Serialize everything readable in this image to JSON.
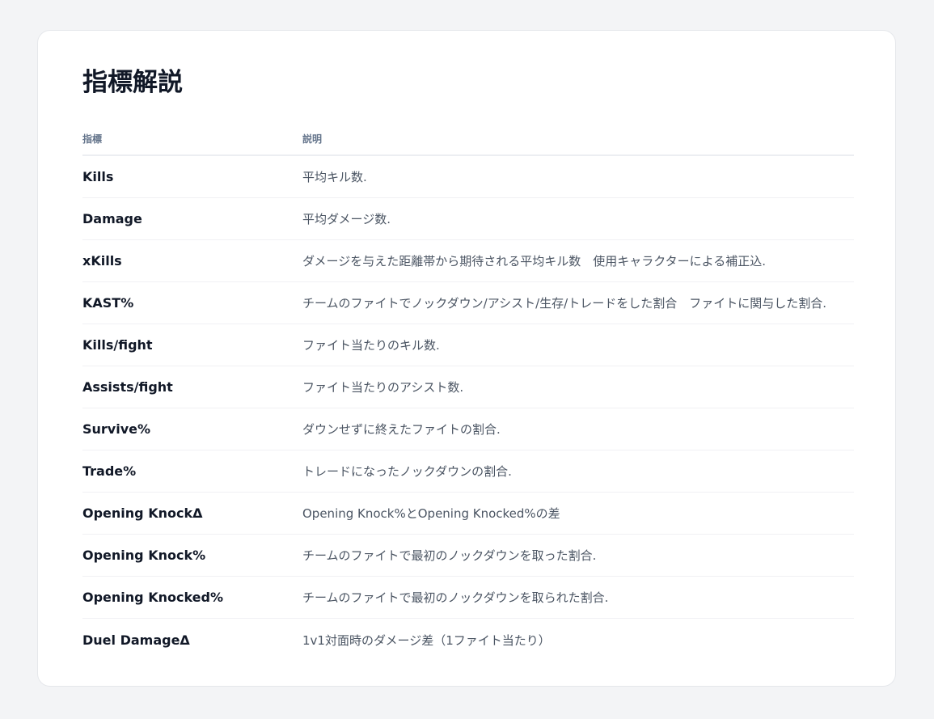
{
  "title": "指標解説",
  "table": {
    "headers": {
      "metric": "指標",
      "description": "説明"
    },
    "rows": [
      {
        "metric": "Kills",
        "description": "平均キル数."
      },
      {
        "metric": "Damage",
        "description": "平均ダメージ数."
      },
      {
        "metric": "xKills",
        "description": "ダメージを与えた距離帯から期待される平均キル数　使用キャラクターによる補正込."
      },
      {
        "metric": "KAST%",
        "description": "チームのファイトでノックダウン/アシスト/生存/トレードをした割合　ファイトに関与した割合."
      },
      {
        "metric": "Kills/fight",
        "description": "ファイト当たりのキル数."
      },
      {
        "metric": "Assists/fight",
        "description": "ファイト当たりのアシスト数."
      },
      {
        "metric": "Survive%",
        "description": "ダウンせずに終えたファイトの割合."
      },
      {
        "metric": "Trade%",
        "description": "トレードになったノックダウンの割合."
      },
      {
        "metric": "Opening KnockΔ",
        "description": "Opening Knock%とOpening Knocked%の差"
      },
      {
        "metric": "Opening Knock%",
        "description": "チームのファイトで最初のノックダウンを取った割合."
      },
      {
        "metric": "Opening Knocked%",
        "description": "チームのファイトで最初のノックダウンを取られた割合."
      },
      {
        "metric": "Duel DamageΔ",
        "description": "1v1対面時のダメージ差（1ファイト当たり）"
      }
    ]
  }
}
